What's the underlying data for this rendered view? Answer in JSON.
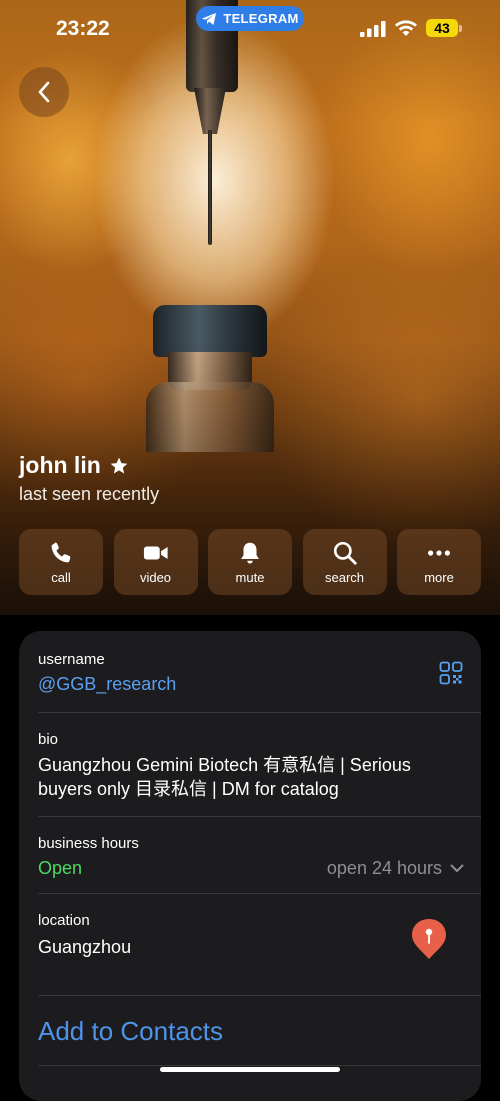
{
  "status_bar": {
    "time": "23:22",
    "app_pill": "TELEGRAM",
    "battery": "43"
  },
  "profile": {
    "name": "john lin",
    "status": "last seen recently"
  },
  "actions": [
    {
      "label": "call",
      "icon": "phone-icon"
    },
    {
      "label": "video",
      "icon": "video-camera-icon"
    },
    {
      "label": "mute",
      "icon": "bell-icon"
    },
    {
      "label": "search",
      "icon": "search-icon"
    },
    {
      "label": "more",
      "icon": "ellipsis-icon"
    }
  ],
  "info": {
    "username": {
      "label": "username",
      "value": "@GGB_research"
    },
    "bio": {
      "label": "bio",
      "value": "Guangzhou Gemini Biotech 有意私信 | Serious buyers only 目录私信 | DM for catalog"
    },
    "business_hours": {
      "label": "business hours",
      "status": "Open",
      "detail": "open 24 hours"
    },
    "location": {
      "label": "location",
      "value": "Guangzhou"
    }
  },
  "add_to_contacts": "Add to Contacts",
  "colors": {
    "accent_blue": "#5aa0f0",
    "open_green": "#4cd964",
    "pin_red": "#e8604a",
    "card_bg": "#1c1c1e"
  }
}
